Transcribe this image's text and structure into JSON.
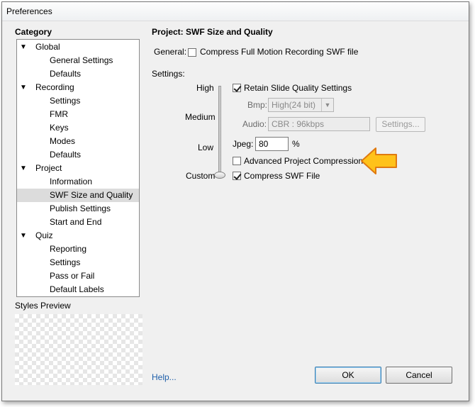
{
  "window": {
    "title": "Preferences"
  },
  "category": {
    "title": "Category",
    "tree": [
      {
        "label": "Global",
        "level": 0,
        "expanded": true
      },
      {
        "label": "General Settings",
        "level": 1
      },
      {
        "label": "Defaults",
        "level": 1
      },
      {
        "label": "Recording",
        "level": 0,
        "expanded": true
      },
      {
        "label": "Settings",
        "level": 1
      },
      {
        "label": "FMR",
        "level": 1
      },
      {
        "label": "Keys",
        "level": 1
      },
      {
        "label": "Modes",
        "level": 1
      },
      {
        "label": "Defaults",
        "level": 1
      },
      {
        "label": "Project",
        "level": 0,
        "expanded": true
      },
      {
        "label": "Information",
        "level": 1
      },
      {
        "label": "SWF Size and Quality",
        "level": 1,
        "selected": true
      },
      {
        "label": "Publish Settings",
        "level": 1
      },
      {
        "label": "Start and End",
        "level": 1
      },
      {
        "label": "Quiz",
        "level": 0,
        "expanded": true
      },
      {
        "label": "Reporting",
        "level": 1
      },
      {
        "label": "Settings",
        "level": 1
      },
      {
        "label": "Pass or Fail",
        "level": 1
      },
      {
        "label": "Default Labels",
        "level": 1
      }
    ],
    "expand_glyph": "▼"
  },
  "styles_preview": {
    "label": "Styles Preview"
  },
  "page": {
    "title": "Project: SWF Size and Quality",
    "general": {
      "label": "General:",
      "compress_fmr": {
        "label": "Compress Full Motion Recording SWF file",
        "checked": false
      }
    },
    "settings_label": "Settings:",
    "quality_levels": [
      "High",
      "Medium",
      "Low",
      "Custom"
    ],
    "quality_selected": "Custom",
    "retain_slide_quality": {
      "label": "Retain Slide Quality Settings",
      "checked": true
    },
    "bmp": {
      "label": "Bmp:",
      "value": "High(24 bit)",
      "arrow": "▼"
    },
    "audio": {
      "label": "Audio:",
      "value": "CBR : 96kbps",
      "settings_button": "Settings..."
    },
    "jpeg": {
      "label": "Jpeg:",
      "value": "80",
      "unit": "%"
    },
    "advanced_compression": {
      "label": "Advanced Project Compression",
      "checked": false
    },
    "compress_swf": {
      "label": "Compress SWF File",
      "checked": true
    }
  },
  "footer": {
    "help": "Help...",
    "ok": "OK",
    "cancel": "Cancel"
  },
  "colors": {
    "arrow_fill": "#ffc21a",
    "arrow_stroke": "#e07a10",
    "link": "#1f5faa"
  },
  "annotation": {
    "icon": "callout-arrow-icon"
  }
}
